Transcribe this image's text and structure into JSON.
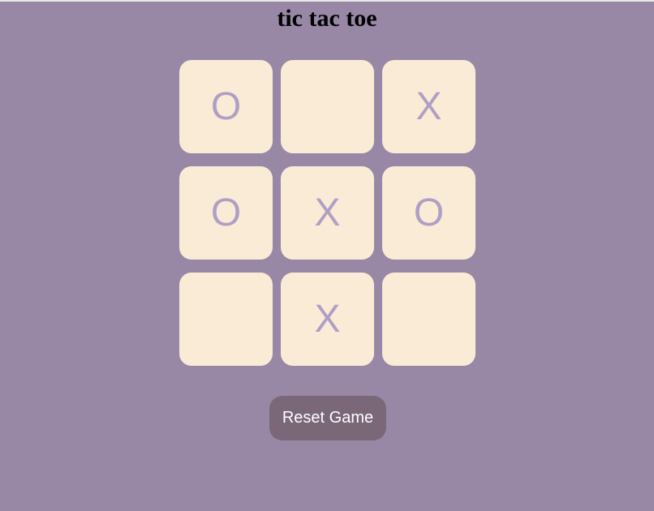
{
  "title": "tic tac toe",
  "board": [
    "O",
    "",
    "X",
    "O",
    "X",
    "O",
    "",
    "X",
    ""
  ],
  "reset_label": "Reset Game",
  "colors": {
    "background": "#9888a5",
    "cell": "#faebd7",
    "mark": "#b09fc4",
    "button": "#7a6878"
  }
}
